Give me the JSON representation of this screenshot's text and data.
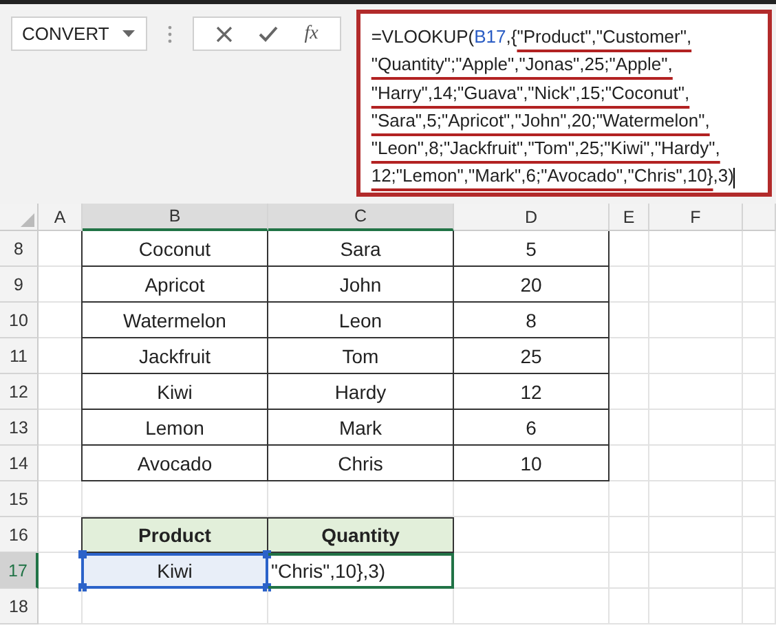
{
  "name_box": {
    "value": "CONVERT"
  },
  "formula_buttons": {
    "function_label": "fx"
  },
  "formula_bar": {
    "lines": [
      [
        {
          "text": "=VLOOKUP(",
          "kind": "plain"
        },
        {
          "text": "B17",
          "kind": "reference"
        },
        {
          "text": ",{",
          "kind": "plain"
        },
        {
          "text": "\"Product\",\"Customer\",",
          "kind": "array"
        }
      ],
      [
        {
          "text": "\"Quantity\";\"Apple\",\"Jonas\",25;\"Apple\",",
          "kind": "array"
        }
      ],
      [
        {
          "text": "\"Harry\",14;\"Guava\",\"Nick\",15;\"Coconut\",",
          "kind": "array"
        }
      ],
      [
        {
          "text": "\"Sara\",5;\"Apricot\",\"John\",20;\"Watermelon\",",
          "kind": "array"
        }
      ],
      [
        {
          "text": "\"Leon\",8;\"Jackfruit\",\"Tom\",25;\"Kiwi\",\"Hardy\",",
          "kind": "array"
        }
      ],
      [
        {
          "text": "12;\"Lemon\",\"Mark\",6;\"Avocado\",\"Chris\",10}",
          "kind": "array"
        },
        {
          "text": ",3)",
          "kind": "plain"
        }
      ]
    ]
  },
  "columns": [
    {
      "label": "A",
      "selected": false
    },
    {
      "label": "B",
      "selected": true
    },
    {
      "label": "C",
      "selected": true
    },
    {
      "label": "D",
      "selected": false
    },
    {
      "label": "E",
      "selected": false
    },
    {
      "label": "F",
      "selected": false
    }
  ],
  "rows": [
    {
      "number": "8",
      "selected": false,
      "cells": [
        {
          "text": "Coconut",
          "kind": "data"
        },
        {
          "text": "Sara",
          "kind": "data"
        },
        {
          "text": "5",
          "kind": "data"
        }
      ]
    },
    {
      "number": "9",
      "selected": false,
      "cells": [
        {
          "text": "Apricot",
          "kind": "data"
        },
        {
          "text": "John",
          "kind": "data"
        },
        {
          "text": "20",
          "kind": "data"
        }
      ]
    },
    {
      "number": "10",
      "selected": false,
      "cells": [
        {
          "text": "Watermelon",
          "kind": "data"
        },
        {
          "text": "Leon",
          "kind": "data"
        },
        {
          "text": "8",
          "kind": "data"
        }
      ]
    },
    {
      "number": "11",
      "selected": false,
      "cells": [
        {
          "text": "Jackfruit",
          "kind": "data"
        },
        {
          "text": "Tom",
          "kind": "data"
        },
        {
          "text": "25",
          "kind": "data"
        }
      ]
    },
    {
      "number": "12",
      "selected": false,
      "cells": [
        {
          "text": "Kiwi",
          "kind": "data"
        },
        {
          "text": "Hardy",
          "kind": "data"
        },
        {
          "text": "12",
          "kind": "data"
        }
      ]
    },
    {
      "number": "13",
      "selected": false,
      "cells": [
        {
          "text": "Lemon",
          "kind": "data"
        },
        {
          "text": "Mark",
          "kind": "data"
        },
        {
          "text": "6",
          "kind": "data"
        }
      ]
    },
    {
      "number": "14",
      "selected": false,
      "cells": [
        {
          "text": "Avocado",
          "kind": "data"
        },
        {
          "text": "Chris",
          "kind": "data"
        },
        {
          "text": "10",
          "kind": "data"
        }
      ]
    },
    {
      "number": "15",
      "selected": false,
      "cells": []
    },
    {
      "number": "16",
      "selected": false,
      "cells": [
        {
          "text": "Product",
          "kind": "header"
        },
        {
          "text": "Quantity",
          "kind": "header"
        }
      ]
    },
    {
      "number": "17",
      "selected": true,
      "cells": [
        {
          "text": "Kiwi",
          "kind": "selected"
        },
        {
          "text": "\"Chris\",10},3)",
          "kind": "editing"
        }
      ]
    },
    {
      "number": "18",
      "selected": false,
      "cells": []
    }
  ]
}
